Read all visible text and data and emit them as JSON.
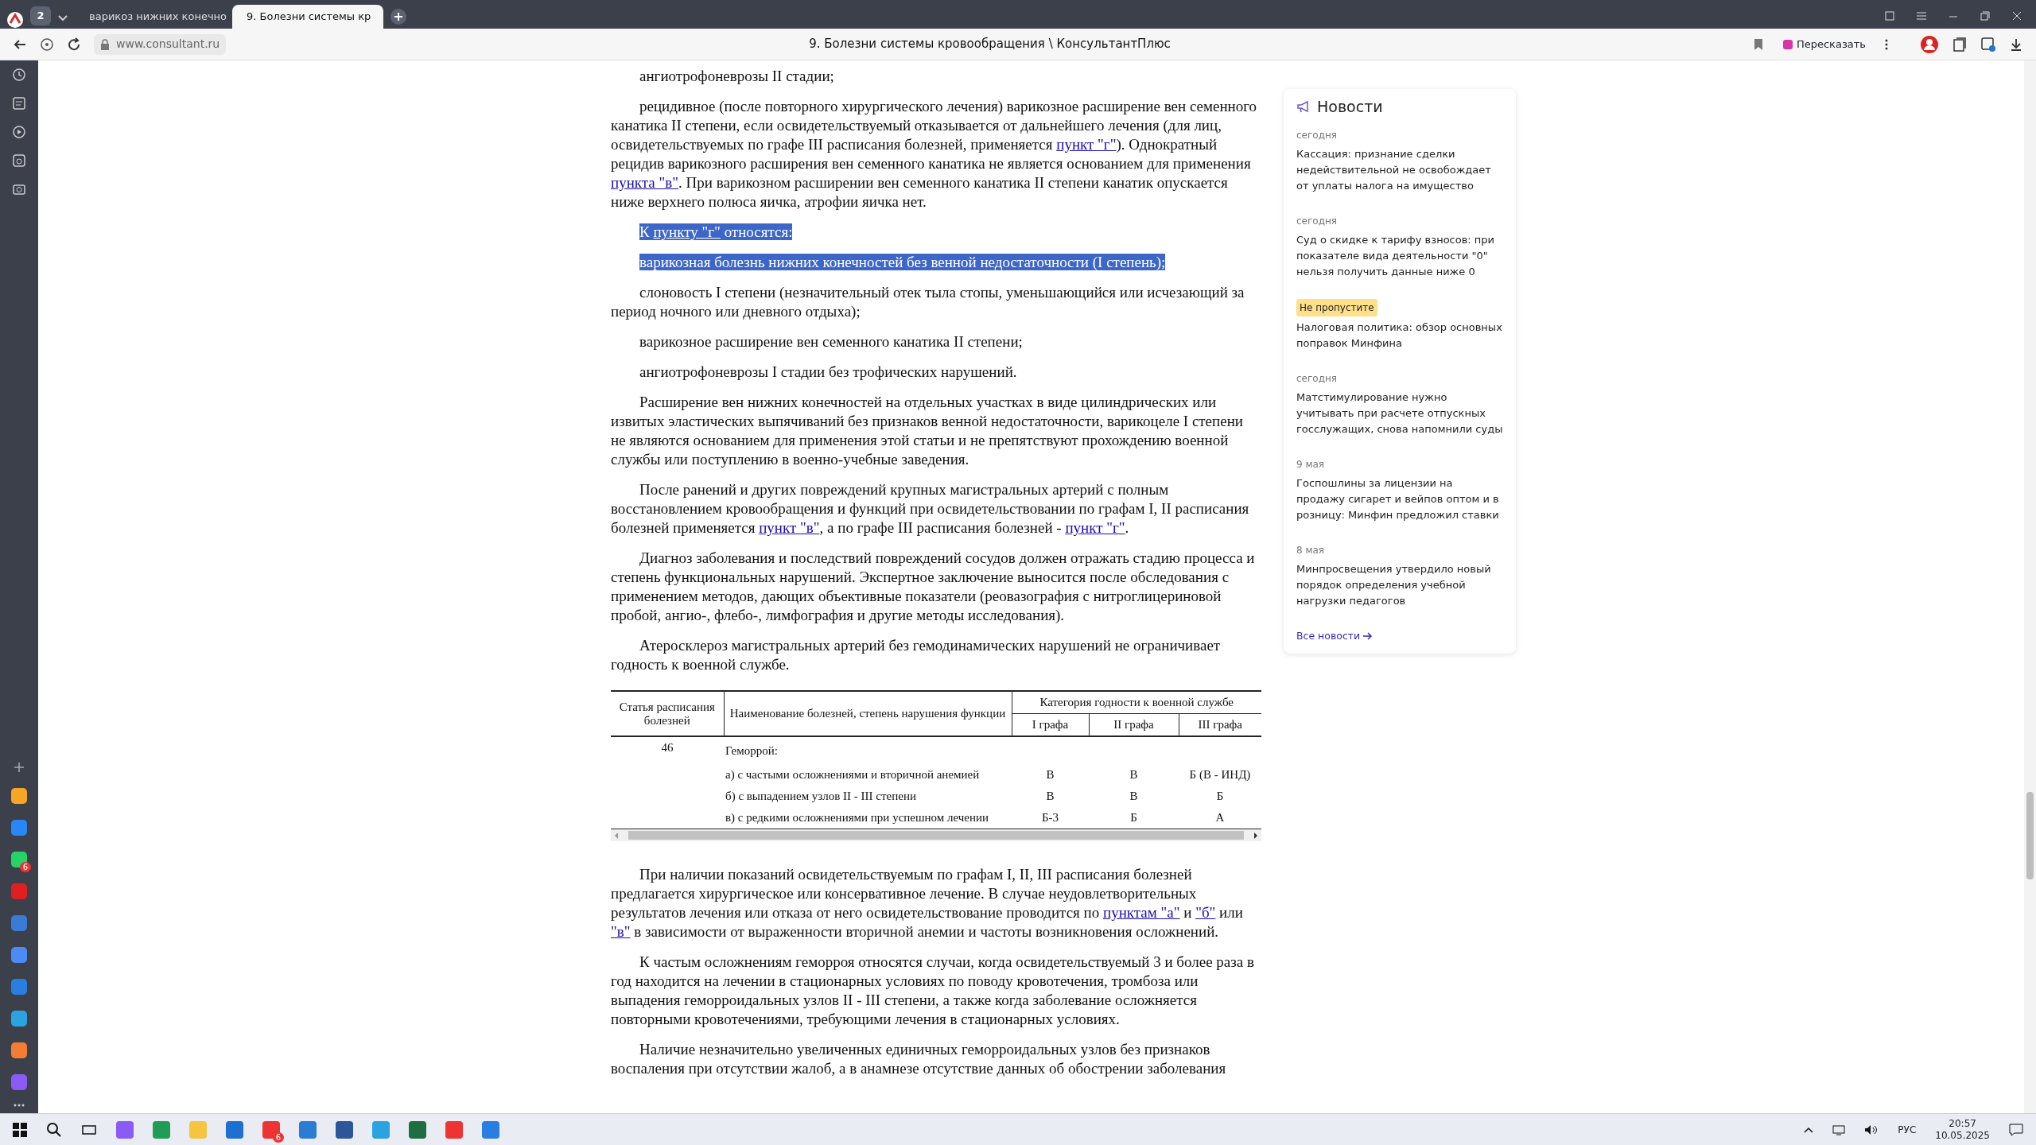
{
  "browser": {
    "tab_count": "2",
    "tabs": [
      {
        "title": "варикоз нижних конечно",
        "selected": false
      },
      {
        "title": "9. Болезни системы кр",
        "selected": true
      }
    ],
    "url": "www.consultant.ru",
    "page_title": "9. Болезни системы кровообращения \\ КонсультантПлюс",
    "retell_button": "Пересказать"
  },
  "document": {
    "paragraphs_top": [
      {
        "selected": false,
        "segments": [
          {
            "kind": "text",
            "text": "ангиотрофоневрозы II стадии;"
          }
        ]
      },
      {
        "selected": false,
        "segments": [
          {
            "kind": "text",
            "text": "рецидивное (после повторного хирургического лечения) варикозное расширение вен семенного канатика II степени, если освидетельствуемый отказывается от дальнейшего лечения (для лиц, освидетельствуемых по графе III расписания болезней, применяется "
          },
          {
            "kind": "link",
            "text": "пункт \"г\""
          },
          {
            "kind": "text",
            "text": "). Однократный рецидив варикозного расширения вен семенного канатика не является основанием для применения "
          },
          {
            "kind": "link",
            "text": "пункта \"в\""
          },
          {
            "kind": "text",
            "text": ". При варикозном расширении вен семенного канатика II степени канатик опускается ниже верхнего полюса яичка, атрофии яичка нет."
          }
        ]
      },
      {
        "selected": true,
        "segments": [
          {
            "kind": "text",
            "text": "К "
          },
          {
            "kind": "link",
            "text": "пункту \"г\""
          },
          {
            "kind": "text",
            "text": " относятся:"
          }
        ]
      },
      {
        "selected": true,
        "segments": [
          {
            "kind": "text",
            "text": "варикозная болезнь нижних конечностей без венной недостаточности (I степень);"
          }
        ]
      },
      {
        "selected": false,
        "segments": [
          {
            "kind": "text",
            "text": "слоновость I степени (незначительный отек тыла стопы, уменьшающийся или исчезающий за период ночного или дневного отдыха);"
          }
        ]
      },
      {
        "selected": false,
        "segments": [
          {
            "kind": "text",
            "text": "варикозное расширение вен семенного канатика II степени;"
          }
        ]
      },
      {
        "selected": false,
        "segments": [
          {
            "kind": "text",
            "text": "ангиотрофоневрозы I стадии без трофических нарушений."
          }
        ]
      },
      {
        "selected": false,
        "segments": [
          {
            "kind": "text",
            "text": "Расширение вен нижних конечностей на отдельных участках в виде цилиндрических или извитых эластических выпячиваний без признаков венной недостаточности, варикоцеле I степени не являются основанием для применения этой статьи и не препятствуют прохождению военной службы или поступлению в военно-учебные заведения."
          }
        ]
      },
      {
        "selected": false,
        "segments": [
          {
            "kind": "text",
            "text": "После ранений и других повреждений крупных магистральных артерий с полным восстановлением кровообращения и функций при освидетельствовании по графам I, II расписания болезней применяется "
          },
          {
            "kind": "link",
            "text": "пункт \"в\""
          },
          {
            "kind": "text",
            "text": ", а по графе III расписания болезней - "
          },
          {
            "kind": "link",
            "text": "пункт \"г\""
          },
          {
            "kind": "text",
            "text": "."
          }
        ]
      },
      {
        "selected": false,
        "segments": [
          {
            "kind": "text",
            "text": "Диагноз заболевания и последствий повреждений сосудов должен отражать стадию процесса и степень функциональных нарушений. Экспертное заключение выносится после обследования с применением методов, дающих объективные показатели (реовазография с нитроглицериновой пробой, ангио-, флебо-, лимфография и другие методы исследования)."
          }
        ]
      },
      {
        "selected": false,
        "segments": [
          {
            "kind": "text",
            "text": "Атеросклероз магистральных артерий без гемодинамических нарушений не ограничивает годность к военной службе."
          }
        ]
      }
    ],
    "table": {
      "header_article": "Статья расписания болезней",
      "header_name": "Наименование болезней, степень нарушения функции",
      "header_category": "Категория годности к военной службе",
      "subheaders": [
        "I графа",
        "II графа",
        "III графа"
      ],
      "rows": [
        {
          "article": "46",
          "name": "Геморрой:",
          "values": []
        },
        {
          "article": "",
          "name": "а) с частыми осложнениями и вторичной анемией",
          "values": [
            "В",
            "В",
            "Б (В - ИНД)"
          ]
        },
        {
          "article": "",
          "name": "б) с выпадением узлов II - III степени",
          "values": [
            "В",
            "В",
            "Б"
          ]
        },
        {
          "article": "",
          "name": "в) с редкими осложнениями при успешном лечении",
          "values": [
            "Б-3",
            "Б",
            "А"
          ]
        }
      ]
    },
    "paragraphs_bottom": [
      {
        "selected": false,
        "segments": [
          {
            "kind": "text",
            "text": "При наличии показаний освидетельствуемым по графам I, II, III расписания болезней предлагается хирургическое или консервативное лечение. В случае неудовлетворительных результатов лечения или отказа от него освидетельствование проводится по "
          },
          {
            "kind": "link",
            "text": "пунктам \"а\""
          },
          {
            "kind": "text",
            "text": " и "
          },
          {
            "kind": "link",
            "text": "\"б\""
          },
          {
            "kind": "text",
            "text": " или "
          },
          {
            "kind": "link",
            "text": "\"в\""
          },
          {
            "kind": "text",
            "text": " в зависимости от выраженности вторичной анемии и частоты возникновения осложнений."
          }
        ]
      },
      {
        "selected": false,
        "segments": [
          {
            "kind": "text",
            "text": "К частым осложнениям геморроя относятся случаи, когда освидетельствуемый 3 и более раза в год находится на лечении в стационарных условиях по поводу кровотечения, тромбоза или выпадения геморроидальных узлов II - III степени, а также когда заболевание осложняется повторными кровотечениями, требующими лечения в стационарных условиях."
          }
        ]
      },
      {
        "selected": false,
        "segments": [
          {
            "kind": "text",
            "text": "Наличие незначительно увеличенных единичных геморроидальных узлов без признаков воспаления при отсутствии жалоб, а в анамнезе отсутствие данных об обострении заболевания"
          }
        ]
      }
    ]
  },
  "news": {
    "title": "Новости",
    "items": [
      {
        "kind": "date",
        "label": "сегодня",
        "headline": "Кассация: признание сделки недействительной не освобождает от уплаты налога на имущество"
      },
      {
        "kind": "date",
        "label": "сегодня",
        "headline": "Суд о скидке к тарифу взносов: при показателе вида деятельности \"0\" нельзя получить данные ниже 0"
      },
      {
        "kind": "tag",
        "label": "Не пропустите",
        "headline": "Налоговая политика: обзор основных поправок Минфина"
      },
      {
        "kind": "date",
        "label": "сегодня",
        "headline": "Матстимулирование нужно учитывать при расчете отпускных госслужащих, снова напомнили суды"
      },
      {
        "kind": "date",
        "label": "9 мая",
        "headline": "Госпошлины за лицензии на продажу сигарет и вейпов оптом и в розницу: Минфин предложил ставки"
      },
      {
        "kind": "date",
        "label": "8 мая",
        "headline": "Минпросвещения утвердило новый порядок определения учебной нагрузки педагогов"
      }
    ],
    "all_link": "Все новости"
  },
  "sidebar": {
    "badge": "6"
  },
  "taskbar": {
    "badge": "6",
    "language": "РУС",
    "time": "20:57",
    "date": "10.05.2025"
  }
}
